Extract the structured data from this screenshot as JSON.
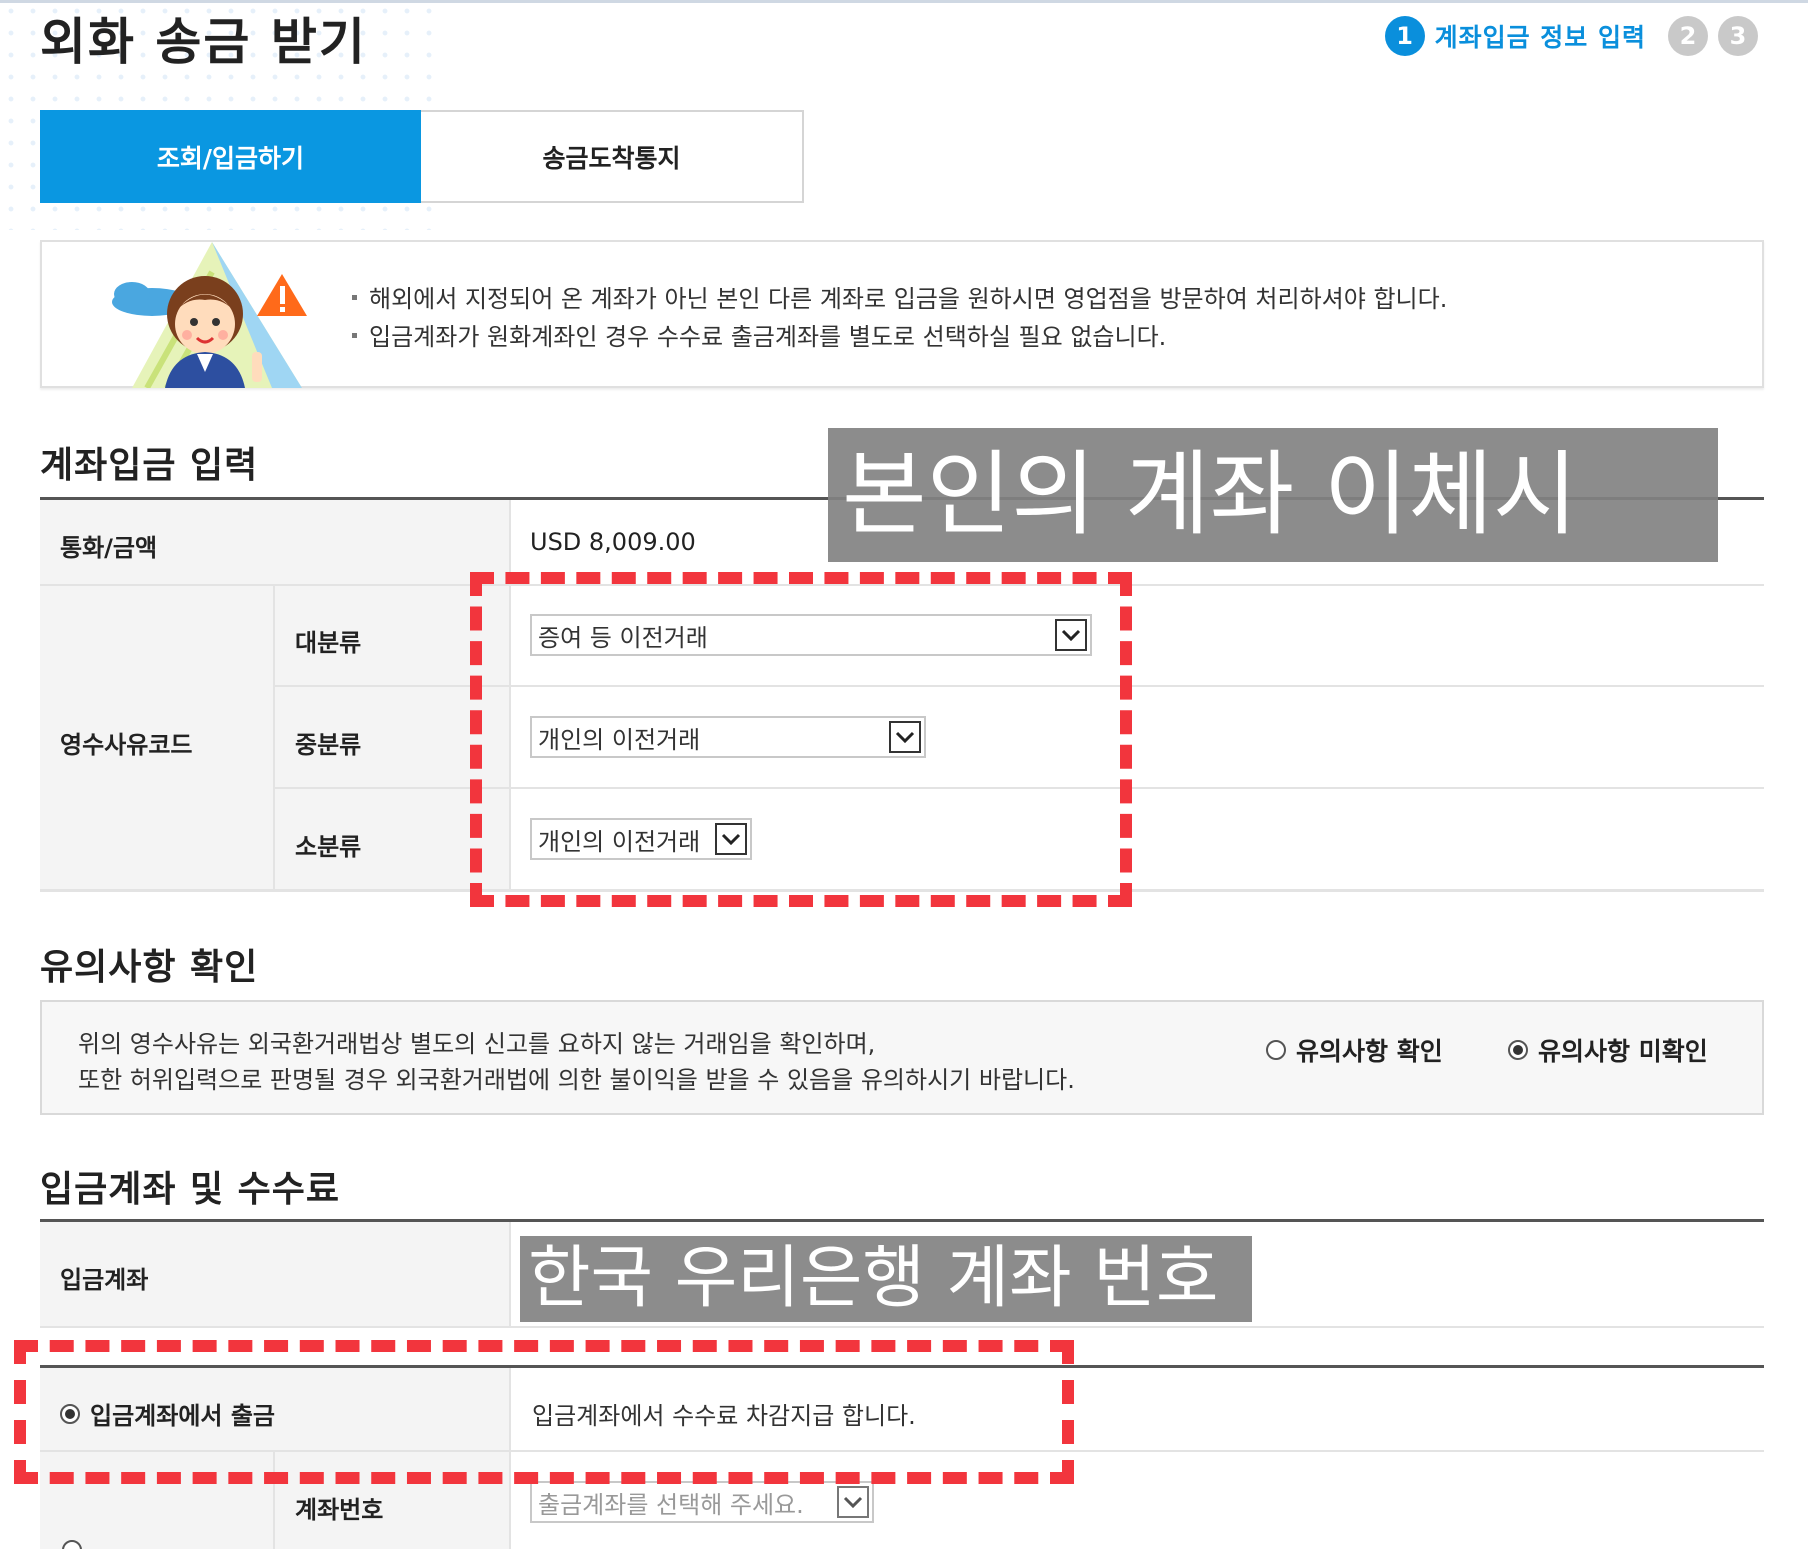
{
  "page": {
    "title": "외화 송금 받기"
  },
  "steps": {
    "step1_num": "1",
    "step1_label": "계좌입금 정보 입력",
    "step2_num": "2",
    "step3_num": "3"
  },
  "tabs": {
    "inquiry_deposit": "조회/입금하기",
    "arrival_notice": "송금도착통지"
  },
  "notice": {
    "line1": "해외에서 지정되어 온 계좌가 아닌 본인 다른 계좌로 입금을 원하시면 영업점을 방문하여 처리하셔야 합니다.",
    "line2": "입금계좌가 원화계좌인 경우 수수료 출금계좌를 별도로 선택하실 필요 없습니다."
  },
  "deposit_input": {
    "title": "계좌입금 입력",
    "currency_amount_label": "통화/금액",
    "currency_amount_value": "USD 8,009.00",
    "receipt_reason_label": "영수사유코드",
    "major_label": "대분류",
    "major_value": "증여 등 이전거래",
    "middle_label": "중분류",
    "middle_value": "개인의 이전거래",
    "minor_label": "소분류",
    "minor_value": "개인의 이전거래"
  },
  "caution": {
    "title": "유의사항 확인",
    "text_line1": "위의 영수사유는 외국환거래법상 별도의 신고를 요하지 않는 거래임을 확인하며,",
    "text_line2": "또한 허위입력으로 판명될 경우 외국환거래법에 의한 불이익을 받을 수 있음을 유의하시기 바랍니다.",
    "option_confirm": "유의사항 확인",
    "option_unconfirm": "유의사항 미확인",
    "selected": "유의사항 미확인"
  },
  "account_fee": {
    "title": "입금계좌 및 수수료",
    "deposit_account_label": "입금계좌",
    "fee_option_label": "입금계좌에서 출금",
    "fee_option_desc": "입금계좌에서 수수료 차감지급 합니다.",
    "account_number_label": "계좌번호",
    "account_select_placeholder": "출금계좌를 선택해 주세요."
  },
  "overlays": {
    "own_account_transfer": "본인의 계좌 이체시",
    "korea_woori_account": "한국 우리은행 계좌 번호"
  },
  "colors": {
    "accent": "#0a97e1",
    "annotation_red": "#f2353d",
    "overlay_gray": "#828282"
  }
}
